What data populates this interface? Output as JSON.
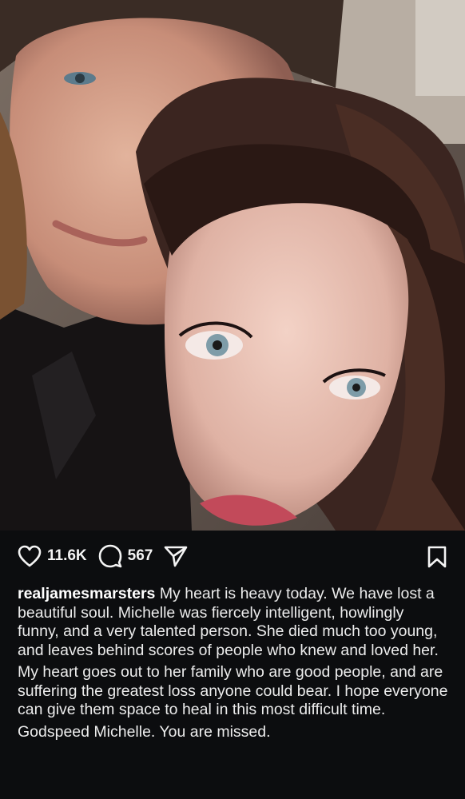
{
  "post": {
    "likes": "11.6K",
    "comments": "567",
    "username": "realjamesmarsters",
    "caption_lines": [
      "My heart is heavy today. We have lost a beautiful soul. Michelle was fiercely intelligent, howlingly funny, and a very talented person. She died much too young, and leaves behind scores of people who knew and loved her.",
      "My heart goes out to her family who are good people, and are suffering the greatest loss anyone could bear. I hope everyone can give them space to heal in this most difficult time.",
      "Godspeed Michelle. You are missed."
    ]
  },
  "icons": {
    "like": "heart-icon",
    "comment": "comment-bubble-icon",
    "share": "send-paper-plane-icon",
    "save": "bookmark-icon"
  },
  "colors": {
    "background": "#0c0d0f",
    "text": "#ececec"
  }
}
